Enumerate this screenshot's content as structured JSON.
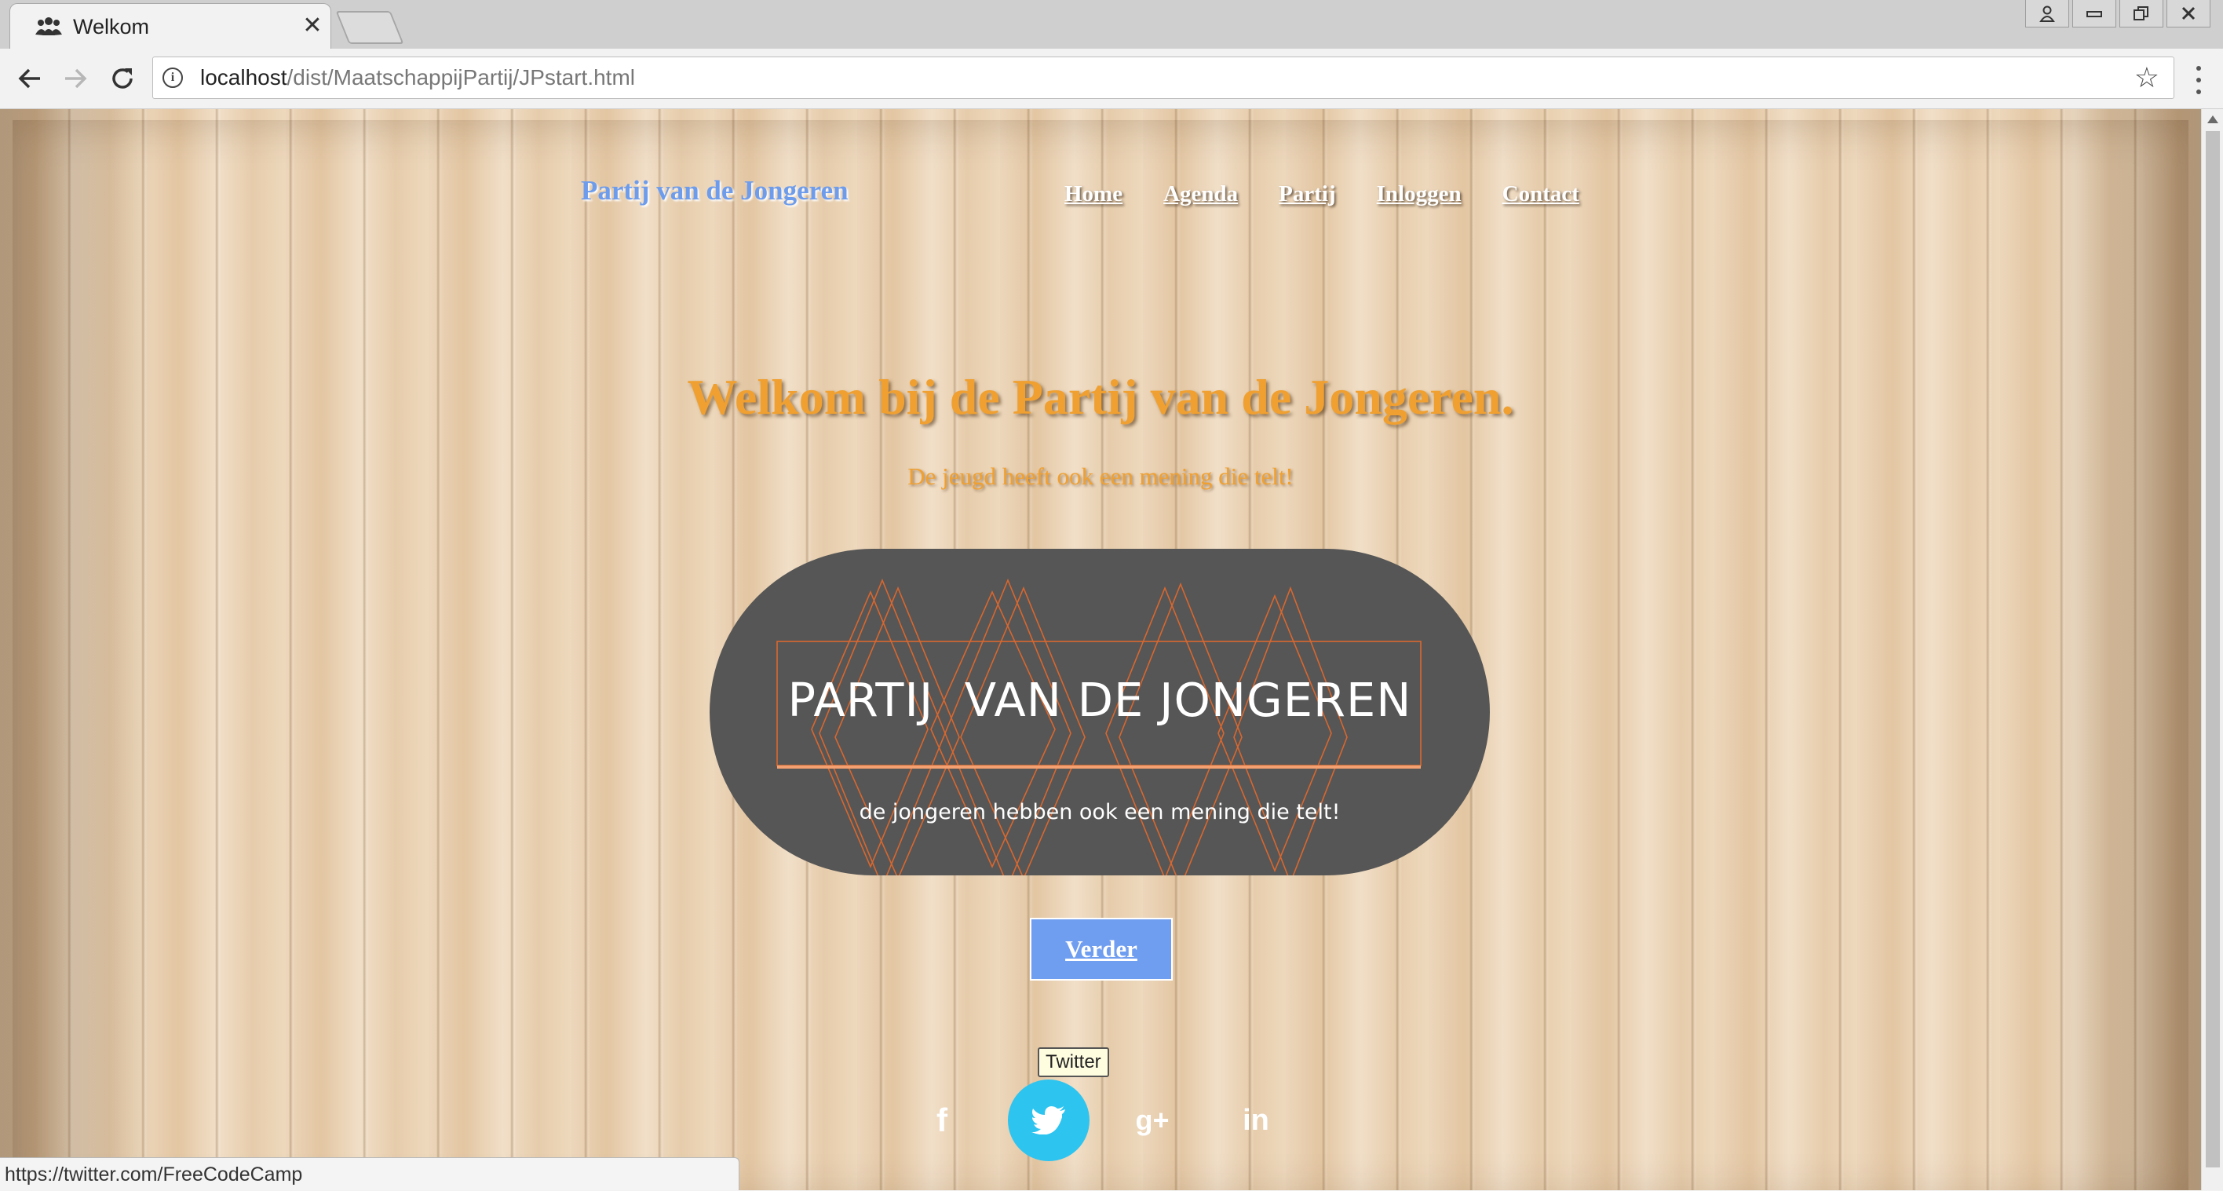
{
  "browser": {
    "tab_title": "Welkom",
    "tab_close": "✕",
    "url_host": "localhost",
    "url_path": "/dist/MaatschappijPartij/JPstart.html"
  },
  "site": {
    "brand": "Partij van de Jongeren",
    "nav": [
      "Home",
      "Agenda",
      "Partij",
      "Inloggen",
      "Contact"
    ],
    "headline": "Welkom bij de Partij van de Jongeren.",
    "subline": "De jeugd heeft ook een mening die telt!",
    "logo": {
      "title": "PARTIJ  VAN DE JONGEREN",
      "subtitle": "de jongeren hebben ook een mening die telt!",
      "background_color": "#565656",
      "accent_color": "#e8692a"
    },
    "cta_label": "Verder",
    "social": [
      {
        "name": "facebook",
        "glyph": "f"
      },
      {
        "name": "twitter",
        "glyph": "🐦"
      },
      {
        "name": "google-plus",
        "glyph": "g+"
      },
      {
        "name": "linkedin",
        "glyph": "in"
      }
    ],
    "tooltip": "Twitter"
  },
  "status_bar": "https://twitter.com/FreeCodeCamp",
  "colors": {
    "brand": "#6d9cec",
    "headline": "#f0a030",
    "cta": "#6f9df0",
    "twitter_active": "#2ec4f0"
  }
}
